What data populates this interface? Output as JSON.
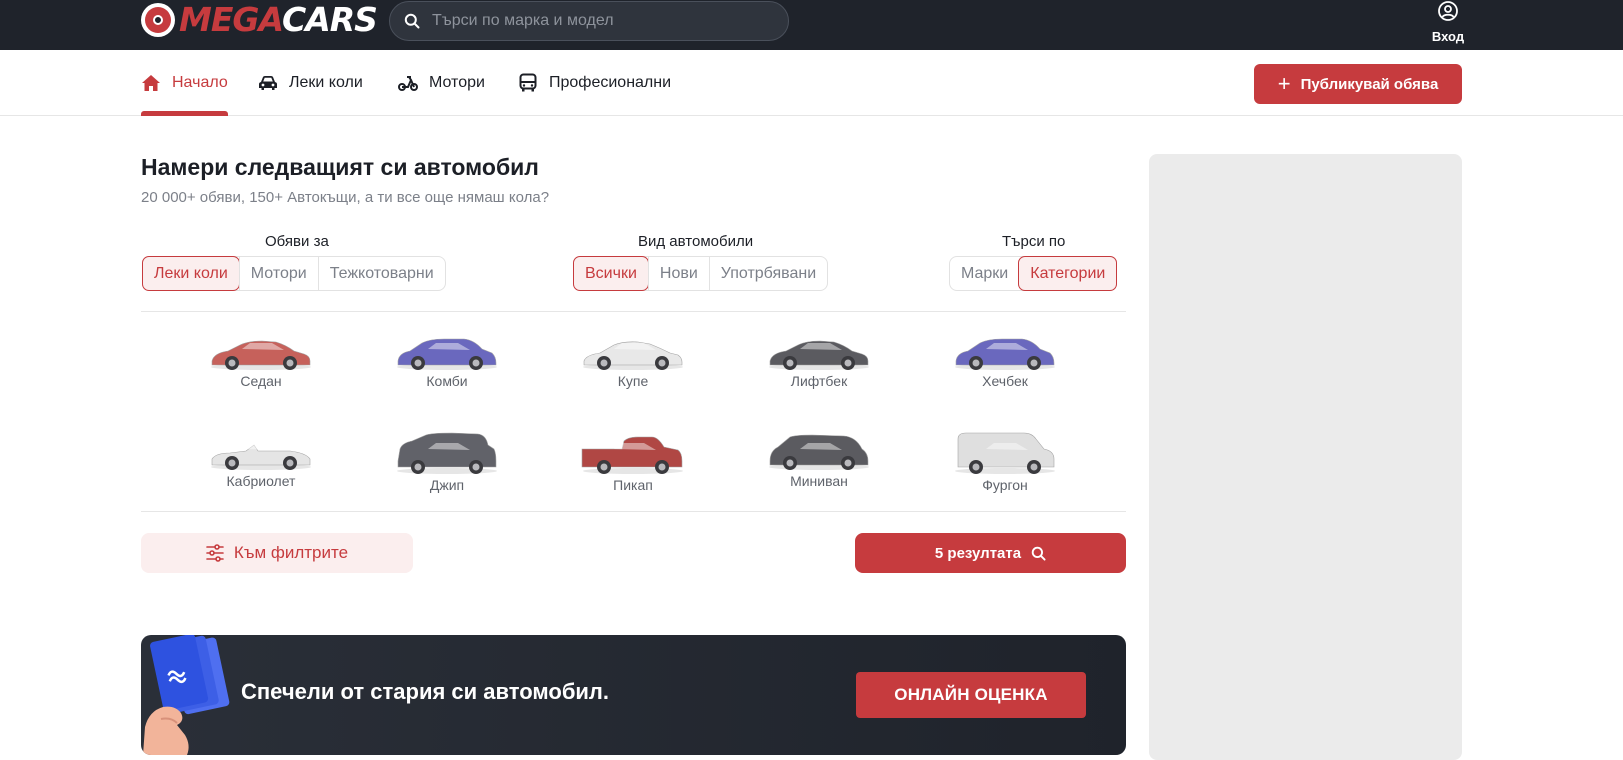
{
  "header": {
    "logo_mega": "MEGA",
    "logo_cars": "CARS",
    "search_placeholder": "Търси по марка и модел",
    "login_label": "Вход"
  },
  "nav": {
    "items": [
      {
        "label": "Начало",
        "icon": "home-icon",
        "active": true
      },
      {
        "label": "Леки коли",
        "icon": "car-icon",
        "active": false
      },
      {
        "label": "Мотори",
        "icon": "scooter-icon",
        "active": false
      },
      {
        "label": "Професионални",
        "icon": "bus-icon",
        "active": false
      }
    ],
    "publish_label": "Публикувай обява"
  },
  "main": {
    "title": "Намери следващият си автомобил",
    "subtitle": "20 000+ обяви, 150+ Автокъщи, а ти все още нямаш кола?",
    "groups": [
      {
        "label": "Обяви за",
        "options": [
          "Леки коли",
          "Мотори",
          "Тежкотоварни"
        ],
        "selected": "Леки коли"
      },
      {
        "label": "Вид автомобили",
        "options": [
          "Всички",
          "Нови",
          "Употрбявани"
        ],
        "selected": "Всички"
      },
      {
        "label": "Търси по",
        "options": [
          "Марки",
          "Категории"
        ],
        "selected": "Категории"
      }
    ],
    "categories": [
      {
        "label": "Седан",
        "color": "#c0504a",
        "shape": "sedan"
      },
      {
        "label": "Комби",
        "color": "#5a58b8",
        "shape": "hatch"
      },
      {
        "label": "Купе",
        "color": "#e6e6e6",
        "shape": "coupe"
      },
      {
        "label": "Лифтбек",
        "color": "#4a4a4f",
        "shape": "sedan"
      },
      {
        "label": "Хечбек",
        "color": "#5a58b8",
        "shape": "hatch"
      },
      {
        "label": "Кабриолет",
        "color": "#e3e3e3",
        "shape": "cabrio"
      },
      {
        "label": "Джип",
        "color": "#505259",
        "shape": "suv"
      },
      {
        "label": "Пикап",
        "color": "#a83430",
        "shape": "pickup"
      },
      {
        "label": "Миниван",
        "color": "#4a4a4f",
        "shape": "minivan"
      },
      {
        "label": "Фургон",
        "color": "#dcdcdc",
        "shape": "van"
      }
    ],
    "filters_label": "Към филтрите",
    "results_label": "5 резултата"
  },
  "banner": {
    "text": "Спечели от стария си автомобил.",
    "button_label": "ОНЛАЙН ОЦЕНКА"
  },
  "colors": {
    "accent": "#c63b3e",
    "dark": "#1f232b"
  }
}
